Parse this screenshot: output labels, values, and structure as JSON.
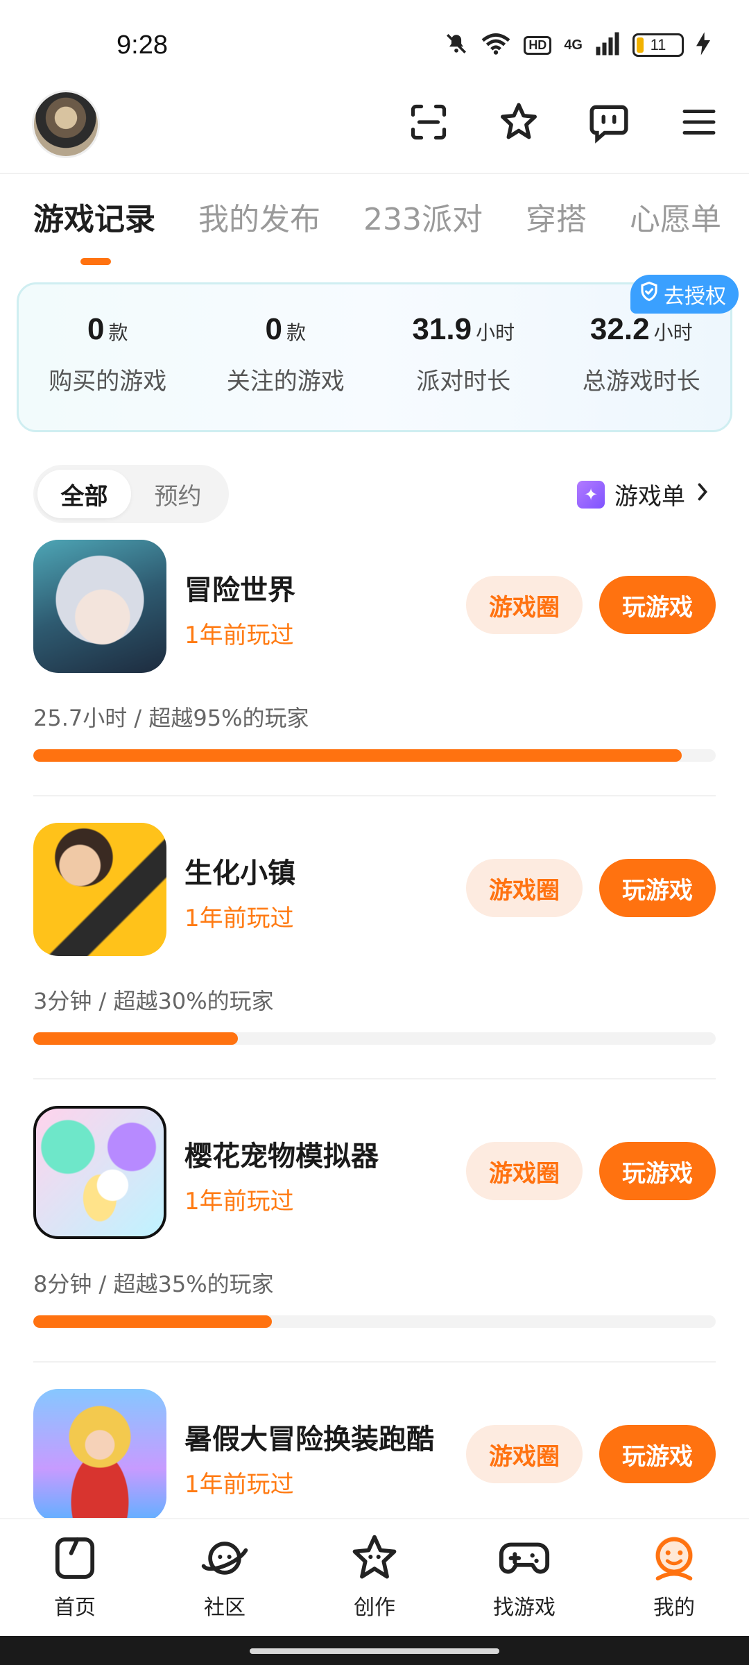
{
  "status_bar": {
    "time": "9:28",
    "hd": "HD",
    "network": "4G",
    "battery": "11"
  },
  "tabs": [
    "游戏记录",
    "我的发布",
    "233派对",
    "穿搭",
    "心愿单"
  ],
  "stats": {
    "auth_badge": "去授权",
    "items": [
      {
        "value": "0",
        "unit": "款",
        "label": "购买的游戏"
      },
      {
        "value": "0",
        "unit": "款",
        "label": "关注的游戏"
      },
      {
        "value": "31.9",
        "unit": "小时",
        "label": "派对时长"
      },
      {
        "value": "32.2",
        "unit": "小时",
        "label": "总游戏时长"
      }
    ]
  },
  "filter": {
    "all": "全部",
    "reserve": "预约",
    "gamelist": "游戏单"
  },
  "games": [
    {
      "name": "冒险世界",
      "played": "1年前玩过",
      "circle_btn": "游戏圈",
      "play_btn": "玩游戏",
      "stat": "25.7小时 / 超越95%的玩家",
      "progress": 0.95
    },
    {
      "name": "生化小镇",
      "played": "1年前玩过",
      "circle_btn": "游戏圈",
      "play_btn": "玩游戏",
      "stat": "3分钟 / 超越30%的玩家",
      "progress": 0.3
    },
    {
      "name": "樱花宠物模拟器",
      "played": "1年前玩过",
      "circle_btn": "游戏圈",
      "play_btn": "玩游戏",
      "stat": "8分钟 / 超越35%的玩家",
      "progress": 0.35
    },
    {
      "name": "暑假大冒险换装跑酷",
      "played": "1年前玩过",
      "circle_btn": "游戏圈",
      "play_btn": "玩游戏"
    }
  ],
  "bottom_nav": [
    {
      "label": "首页",
      "icon": "home-icon"
    },
    {
      "label": "社区",
      "icon": "planet-icon"
    },
    {
      "label": "创作",
      "icon": "star-face-icon"
    },
    {
      "label": "找游戏",
      "icon": "gamepad-icon"
    },
    {
      "label": "我的",
      "icon": "profile-icon"
    }
  ],
  "colors": {
    "accent": "#ff7210",
    "accent_light": "#fdebe0",
    "badge_blue": "#3aa0ff"
  }
}
